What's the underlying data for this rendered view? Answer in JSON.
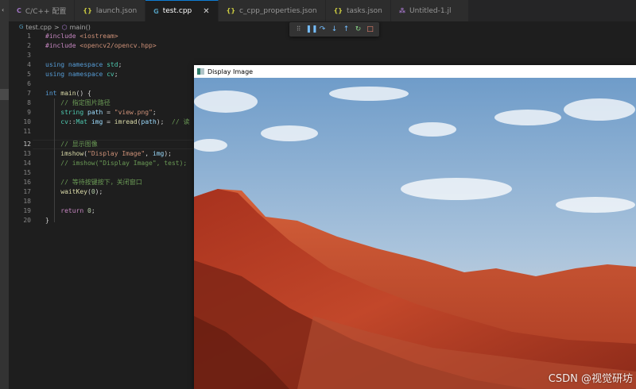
{
  "tabs": [
    {
      "icon": "C",
      "label": "C/C++ 配置",
      "kind": "c"
    },
    {
      "icon": "{}",
      "label": "launch.json",
      "kind": "json"
    },
    {
      "icon": "G",
      "label": "test.cpp",
      "kind": "cpp",
      "active": true,
      "close": "✕"
    },
    {
      "icon": "{}",
      "label": "c_cpp_properties.json",
      "kind": "json"
    },
    {
      "icon": "{}",
      "label": "tasks.json",
      "kind": "json"
    },
    {
      "icon": "⁂",
      "label": "Untitled-1.jl",
      "kind": "jl"
    }
  ],
  "breadcrumb": {
    "file": "test.cpp",
    "separator": ">",
    "symbol": "main()"
  },
  "debug_toolbar": [
    "grip",
    "pause",
    "step-over",
    "step-into",
    "step-out",
    "restart",
    "stop"
  ],
  "editor": {
    "current_line": 12,
    "lines": [
      {
        "n": "1",
        "text": "#include <iostream>"
      },
      {
        "n": "2",
        "text": "#include <opencv2/opencv.hpp>"
      },
      {
        "n": "3",
        "text": ""
      },
      {
        "n": "4",
        "text": "using namespace std;"
      },
      {
        "n": "5",
        "text": "using namespace cv;"
      },
      {
        "n": "6",
        "text": ""
      },
      {
        "n": "7",
        "text": "int main() {"
      },
      {
        "n": "8",
        "text": "    // 指定图片路径"
      },
      {
        "n": "9",
        "text": "    string path = \"view.png\";"
      },
      {
        "n": "10",
        "text": "    cv::Mat img = imread(path);  // 读"
      },
      {
        "n": "11",
        "text": ""
      },
      {
        "n": "12",
        "text": "    // 显示图像"
      },
      {
        "n": "13",
        "text": "    imshow(\"Display Image\", img);"
      },
      {
        "n": "14",
        "text": "    // imshow(\"Display Image\", test);"
      },
      {
        "n": "15",
        "text": ""
      },
      {
        "n": "16",
        "text": "    // 等待按键按下，关闭窗口"
      },
      {
        "n": "17",
        "text": "    waitKey(0);"
      },
      {
        "n": "18",
        "text": ""
      },
      {
        "n": "19",
        "text": "    return 0;"
      },
      {
        "n": "20",
        "text": "}"
      }
    ]
  },
  "image_window": {
    "title": "Display Image"
  },
  "watermark": "CSDN @视觉研坊",
  "colors": {
    "accent": "#0e7cd4",
    "editor_bg": "#1e1e1e",
    "tab_bar_bg": "#252526"
  }
}
